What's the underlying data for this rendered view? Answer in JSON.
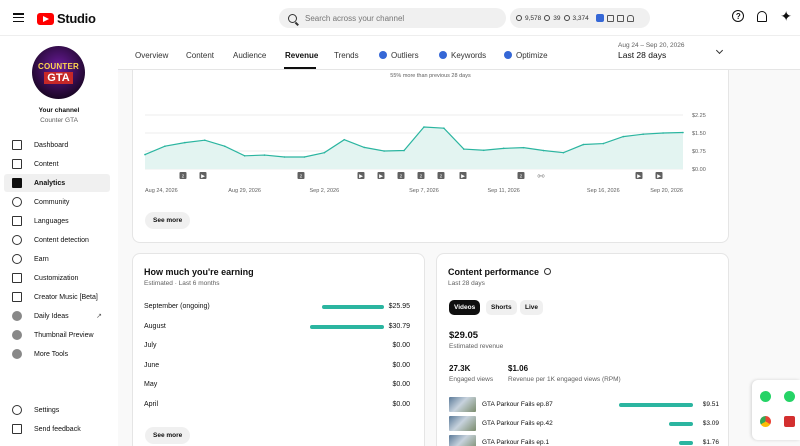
{
  "app": {
    "logo_text": "Studio"
  },
  "search": {
    "placeholder": "Search across your channel"
  },
  "topstats": {
    "subscribers": "9,578",
    "views": "39",
    "watch": "3,374"
  },
  "channel": {
    "title": "Your channel",
    "name": "Counter GTA",
    "avatar_line1": "COUNTER",
    "avatar_line2": "GTA"
  },
  "sidebar": {
    "items": [
      {
        "label": "Dashboard",
        "icon": "dashboard-icon"
      },
      {
        "label": "Content",
        "icon": "content-icon"
      },
      {
        "label": "Analytics",
        "icon": "analytics-icon"
      },
      {
        "label": "Community",
        "icon": "community-icon"
      },
      {
        "label": "Languages",
        "icon": "languages-icon"
      },
      {
        "label": "Content detection",
        "icon": "copyright-icon"
      },
      {
        "label": "Earn",
        "icon": "earn-icon"
      },
      {
        "label": "Customization",
        "icon": "customization-icon"
      },
      {
        "label": "Creator Music [Beta]",
        "icon": "music-icon"
      },
      {
        "label": "Daily Ideas",
        "icon": "extension-icon"
      },
      {
        "label": "Thumbnail Preview",
        "icon": "extension-icon"
      },
      {
        "label": "More Tools",
        "icon": "extension-icon"
      },
      {
        "label": "Settings",
        "icon": "settings-icon"
      },
      {
        "label": "Send feedback",
        "icon": "feedback-icon"
      }
    ]
  },
  "tabs": [
    "Overview",
    "Content",
    "Audience",
    "Revenue",
    "Trends",
    "Outliers",
    "Keywords",
    "Optimize"
  ],
  "date": {
    "range": "Aug 24 – Sep 20, 2026",
    "label": "Last 28 days"
  },
  "revenue_chart": {
    "subtitle": "55% more than previous 28 days",
    "see_more": "See more"
  },
  "chart_data": {
    "type": "area",
    "x": [
      "Aug 24, 2026",
      "Aug 25",
      "Aug 26",
      "Aug 27",
      "Aug 28",
      "Aug 29, 2026",
      "Aug 30",
      "Aug 31",
      "Sep 1",
      "Sep 2, 2026",
      "Sep 3",
      "Sep 4",
      "Sep 5",
      "Sep 6",
      "Sep 7, 2026",
      "Sep 8",
      "Sep 9",
      "Sep 10",
      "Sep 11, 2026",
      "Sep 12",
      "Sep 13",
      "Sep 14",
      "Sep 15",
      "Sep 16, 2026",
      "Sep 17",
      "Sep 18",
      "Sep 19",
      "Sep 20, 2026"
    ],
    "x_tick_labels": [
      "Aug 24, 2026",
      "Aug 29, 2026",
      "Sep 2, 2026",
      "Sep 7, 2026",
      "Sep 11, 2026",
      "Sep 16, 2026",
      "Sep 20, 2026"
    ],
    "values": [
      0.6,
      0.95,
      1.1,
      1.2,
      0.95,
      0.55,
      0.58,
      0.5,
      0.5,
      0.68,
      1.22,
      0.9,
      0.75,
      0.77,
      1.75,
      1.7,
      0.83,
      0.78,
      0.86,
      0.89,
      0.77,
      0.68,
      1.02,
      1.06,
      1.35,
      1.45,
      1.5,
      1.52
    ],
    "y_tick_labels": [
      "$0.00",
      "$0.75",
      "$1.50",
      "$2.25"
    ],
    "ylim": [
      0,
      2.25
    ],
    "markers": [
      "2",
      "▶",
      "2",
      "▶",
      "▶",
      "2",
      "2",
      "2",
      "▶",
      "▶",
      "2",
      "0•0",
      "▶",
      "▶"
    ],
    "color": "#2bb5a0"
  },
  "earnings": {
    "title": "How much you're earning",
    "subtitle": "Estimated · Last 6 months",
    "rows": [
      {
        "month": "September (ongoing)",
        "value": "$25.95",
        "amount": 25.95
      },
      {
        "month": "August",
        "value": "$30.79",
        "amount": 30.79
      },
      {
        "month": "July",
        "value": "$0.00",
        "amount": 0
      },
      {
        "month": "June",
        "value": "$0.00",
        "amount": 0
      },
      {
        "month": "May",
        "value": "$0.00",
        "amount": 0
      },
      {
        "month": "April",
        "value": "$0.00",
        "amount": 0
      }
    ],
    "see_more": "See more"
  },
  "performance": {
    "title": "Content performance",
    "subtitle": "Last 28 days",
    "chips": [
      "Videos",
      "Shorts",
      "Live"
    ],
    "revenue": "$29.05",
    "revenue_label": "Estimated revenue",
    "views": "27.3K",
    "views_label": "Engaged views",
    "rpm": "$1.06",
    "rpm_label": "Revenue per 1K engaged views (RPM)",
    "videos": [
      {
        "title": "GTA Parkour Fails ep.87",
        "value": "$9.51",
        "amount": 9.51
      },
      {
        "title": "GTA Parkour Fails ep.42",
        "value": "$3.09",
        "amount": 3.09
      },
      {
        "title": "GTA Parkour Fails ep.1",
        "value": "$1.76",
        "amount": 1.76
      }
    ]
  }
}
